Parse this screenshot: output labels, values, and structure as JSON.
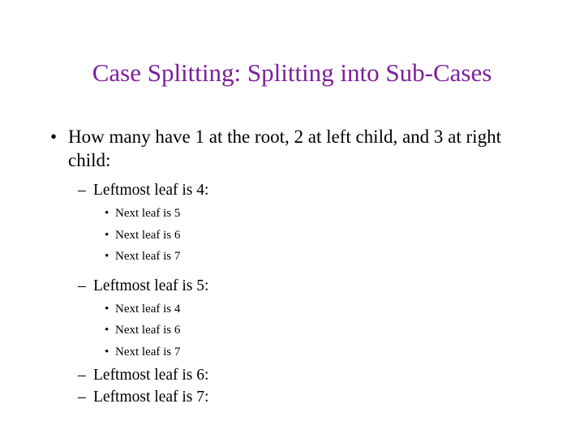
{
  "slide": {
    "title": "Case Splitting:  Splitting into Sub-Cases",
    "title_color": "#7d1f9c",
    "body_color": "#000000",
    "background_color": "#ffffff",
    "bullets": {
      "level1_glyph": "•",
      "level2_glyph": "–",
      "level3_glyph": "•"
    },
    "content": [
      {
        "level": 1,
        "text": "How many have 1 at the root, 2 at left child, and 3 at right child:"
      },
      {
        "level": 2,
        "text": "Leftmost leaf is 4:"
      },
      {
        "level": 3,
        "text": "Next leaf is 5"
      },
      {
        "level": 3,
        "text": "Next leaf is 6"
      },
      {
        "level": 3,
        "text": "Next leaf is 7"
      },
      {
        "level": 2,
        "text": "Leftmost leaf is 5:"
      },
      {
        "level": 3,
        "text": "Next leaf is 4"
      },
      {
        "level": 3,
        "text": "Next leaf is 6"
      },
      {
        "level": 3,
        "text": "Next leaf is 7"
      },
      {
        "level": 2,
        "text": "Leftmost leaf is 6:"
      },
      {
        "level": 2,
        "text": "Leftmost leaf is 7:"
      }
    ]
  }
}
